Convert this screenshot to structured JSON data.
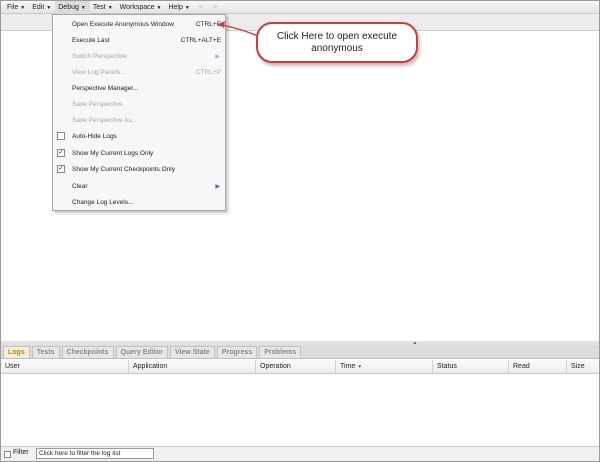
{
  "menubar": {
    "items": [
      {
        "label": "File"
      },
      {
        "label": "Edit"
      },
      {
        "label": "Debug"
      },
      {
        "label": "Test"
      },
      {
        "label": "Workspace"
      },
      {
        "label": "Help"
      }
    ],
    "back_glyph": "<",
    "forward_glyph": ">"
  },
  "debug_menu": {
    "items": [
      {
        "label": "Open Execute Anonymous Window",
        "shortcut": "CTRL+E",
        "enabled": true
      },
      {
        "label": "Execute Last",
        "shortcut": "CTRL+ALT+E",
        "enabled": true
      },
      {
        "label": "Switch Perspective",
        "submenu": true,
        "enabled": false
      },
      {
        "label": "View Log Panels...",
        "shortcut": "CTRL+P",
        "enabled": false
      },
      {
        "label": "Perspective Manager...",
        "enabled": true
      },
      {
        "label": "Save Perspective",
        "enabled": false
      },
      {
        "label": "Save Perspective As...",
        "enabled": false
      },
      {
        "label": "Auto-Hide Logs",
        "checkbox": true,
        "checked": false,
        "enabled": true
      },
      {
        "label": "Show My Current Logs Only",
        "checkbox": true,
        "checked": true,
        "enabled": true
      },
      {
        "label": "Show My Current Checkpoints Only",
        "checkbox": true,
        "checked": true,
        "enabled": true
      },
      {
        "label": "Clear",
        "submenu": true,
        "enabled": true
      },
      {
        "label": "Change Log Levels...",
        "enabled": true
      }
    ],
    "submenu_glyph": "▶",
    "check_glyph": "✓"
  },
  "callout": {
    "text": "Click Here to open execute anonymous",
    "border_color": "#d23a3a"
  },
  "bottom_panel": {
    "tabs": [
      {
        "label": "Logs",
        "active": true
      },
      {
        "label": "Tests"
      },
      {
        "label": "Checkpoints"
      },
      {
        "label": "Query Editor"
      },
      {
        "label": "View State"
      },
      {
        "label": "Progress"
      },
      {
        "label": "Problems"
      }
    ],
    "columns": [
      {
        "label": "User"
      },
      {
        "label": "Application"
      },
      {
        "label": "Operation"
      },
      {
        "label": "Time",
        "sorted": true
      },
      {
        "label": "Status"
      },
      {
        "label": "Read"
      },
      {
        "label": "Size"
      }
    ],
    "sort_glyph": "▼",
    "filter": {
      "label": "Filter",
      "placeholder": "Click here to filter the log list"
    }
  },
  "colors": {
    "active_tab_text": "#d07818",
    "submenu_arrow": "#3a6fc0"
  }
}
